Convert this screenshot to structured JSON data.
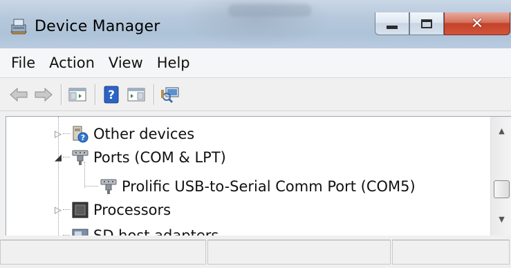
{
  "window": {
    "title": "Device Manager",
    "app_icon": "device-manager-icon",
    "buttons": {
      "minimize": "minimize-icon",
      "maximize": "maximize-icon",
      "close": "close-icon"
    }
  },
  "menu": {
    "items": [
      "File",
      "Action",
      "View",
      "Help"
    ]
  },
  "toolbar": {
    "icons": [
      "back-arrow-icon",
      "forward-arrow-icon",
      "show-hide-console-tree-icon",
      "help-icon",
      "show-action-pane-icon",
      "scan-hardware-changes-icon"
    ]
  },
  "tree": {
    "items": [
      {
        "label": "Other devices",
        "icon": "other-devices-icon",
        "state": "collapsed"
      },
      {
        "label": "Ports (COM & LPT)",
        "icon": "port-icon",
        "state": "expanded"
      },
      {
        "label": "Prolific USB-to-Serial Comm Port (COM5)",
        "icon": "port-icon",
        "state": "leaf"
      },
      {
        "label": "Processors",
        "icon": "processor-icon",
        "state": "collapsed"
      },
      {
        "label": "SD host adapters",
        "icon": "sd-adapter-icon",
        "state": "collapsed"
      }
    ]
  },
  "scrollbar": {
    "position_fraction": 0.55
  },
  "status": {
    "panes": [
      "",
      "",
      ""
    ]
  },
  "colors": {
    "close_button": "#c4432a",
    "titlebar": "#b7c9dc",
    "expander": "#7a7a7a"
  }
}
